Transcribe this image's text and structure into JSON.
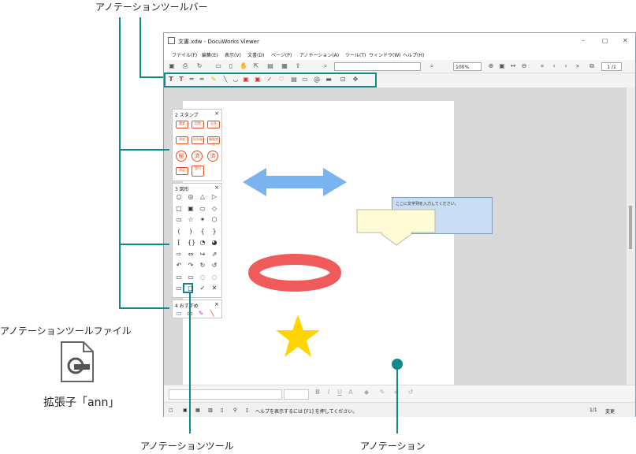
{
  "callouts": {
    "toolbar": "アノテーションツールバー",
    "tool_file": "アノテーションツールファイル",
    "file_ext": "拡張子「ann」",
    "tool": "アノテーションツール",
    "annotation": "アノテーション"
  },
  "window": {
    "title": "文書.xdw - DocuWorks Viewer",
    "menu": [
      "ファイル(F)",
      "編集(E)",
      "表示(V)",
      "文書(D)",
      "ページ(P)",
      "アノテーション(A)",
      "ツール(T)",
      "ウィンドウ(W)",
      "ヘルプ(H)"
    ],
    "zoom": "100%",
    "page_indicator": "1 /1",
    "status_help": "ヘルプを表示するには [F1] を押してください。",
    "status_page": "1/1",
    "status_mode": "変更"
  },
  "panels": {
    "stamp": {
      "title": "2 スタンプ",
      "items": [
        "重要",
        "回覧",
        "至急",
        "承認",
        "社外秘",
        "複製禁止",
        "秘",
        "済",
        "済",
        "承認",
        "受付",
        "スタンプ"
      ]
    },
    "shapes": {
      "title": "3 図形"
    },
    "favorites": {
      "title": "4 おすすめ"
    },
    "close": "×"
  },
  "annotations": {
    "stamp_text": "至急",
    "textbox_placeholder": "ここに文字列を入力してください。"
  },
  "colors": {
    "accent": "#0e8a8a",
    "stamp": "#e04a14",
    "arrow": "#7ab3f0",
    "ellipse": "#f05a5a",
    "star": "#ffd400",
    "textbox": "#c9def4",
    "down_arrow": "#fffbd6"
  }
}
